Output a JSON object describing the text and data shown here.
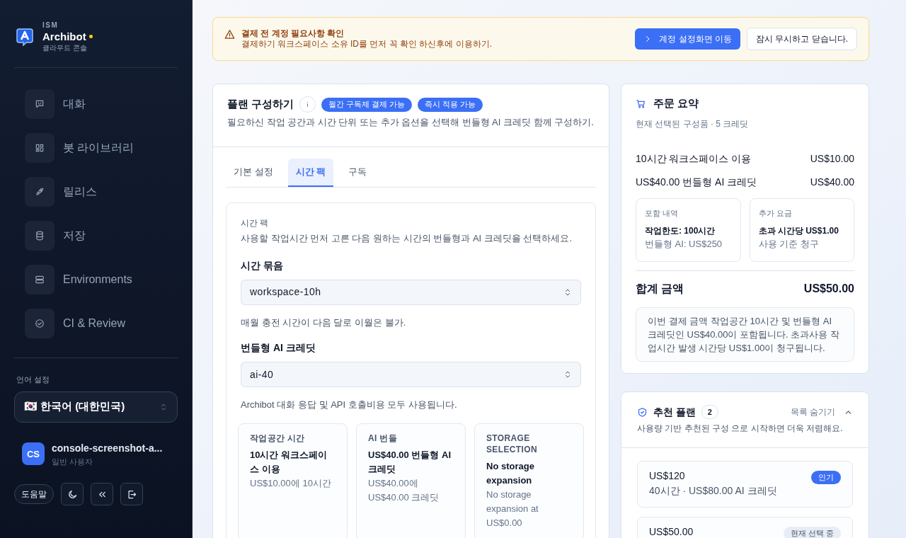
{
  "sidebar": {
    "brand": {
      "org": "ISM",
      "name": "Archibot",
      "subtitle": "클라우드 콘솔",
      "status_dot": true
    },
    "nav_items": [
      {
        "label": "대화"
      },
      {
        "label": "봇 라이브러리"
      },
      {
        "label": "릴리스"
      },
      {
        "label": "저장"
      },
      {
        "label": "Environments"
      },
      {
        "label": "CI & Review"
      }
    ],
    "language": {
      "label": "언어 설정",
      "value": "🇰🇷 한국어 (대한민국)"
    },
    "user": {
      "initials": "CS",
      "name": "console-screenshot-a...",
      "role": "일반 사용자"
    },
    "help_button": "도움말"
  },
  "banner": {
    "title": "결제 전 계정 필요사항 확인",
    "message": "결제하기 워크스페이스 소유 ID를 먼저 꼭 확인 하신후에 이용하기.",
    "primary_action": "계정 설정화면 이동",
    "secondary_action": "잠시 무시하고 닫습니다."
  },
  "plan_card": {
    "title": "플랜 구성하기",
    "badges": [
      "월간 구독제 결제 가능",
      "즉시 적용 가능"
    ],
    "description": "필요하신 작업 공간과 시간 단위 또는 추가 옵션을 선택해 번들형 AI 크레딧 함께 구성하기.",
    "tabs": [
      {
        "label": "기본 설정",
        "selected": false
      },
      {
        "label": "시간 팩",
        "selected": true
      },
      {
        "label": "구독",
        "selected": false
      }
    ],
    "panel": {
      "title": "시간 팩",
      "description": "사용할 작업시간 먼저 고른 다음 원하는 시간의 번들형과 AI 크레딧을 선택하세요.",
      "fields": [
        {
          "label": "시간 묶음",
          "value": "workspace-10h",
          "help": "매월 충전 시간이 다음 달로 이월은 불가."
        },
        {
          "label": "번들형 AI 크레딧",
          "value": "ai-40",
          "help": "Archibot 대화 응답 및 API 호출비용 모두 사용됩니다."
        }
      ],
      "options": [
        {
          "label": "작업공간 시간",
          "title": "10시간 워크스페이스 이용",
          "detail": "US$10.00에 10시간"
        },
        {
          "label": "AI 번들",
          "title": "US$40.00 번들형 AI 크레딧",
          "detail": "US$40.00에 US$40.00 크레딧"
        },
        {
          "label": "STORAGE SELECTION",
          "title": "No storage expansion",
          "detail": "No storage expansion at US$0.00"
        }
      ]
    }
  },
  "summary": {
    "title": "주문 요약",
    "subtitle": "현재 선택된 구성품 · 5 크레딧",
    "lines": [
      {
        "label": "10시간 워크스페이스 이용",
        "amount": "US$10.00"
      },
      {
        "label": "US$40.00 번들형 AI 크레딧",
        "amount": "US$40.00"
      }
    ],
    "details": [
      {
        "label": "포함 내역",
        "primary": "작업한도: 100시간",
        "secondary": "번들형 AI: US$250"
      },
      {
        "label": "추가 요금",
        "primary": "초과 시간당 US$1.00",
        "secondary": "사용 기준 청구"
      }
    ],
    "total": {
      "label": "합계 금액",
      "amount": "US$50.00"
    },
    "note": "이번 결제 금액 작업공간 10시간 및 번들형 AI 크레딧인 US$40.00이 포함됩니다. 초과사용 작업시간 발생 시간당 US$1.00이 청구됩니다."
  },
  "recommended": {
    "title": "추천 플랜",
    "count": "2",
    "toggle_label": "목록 숨기기",
    "expanded": true,
    "description": "사용량 기반 추천된 구성 으로 시작하면 더욱 저렴해요.",
    "items": [
      {
        "price": "US$120",
        "detail": "40시간 · US$80.00 AI 크레딧",
        "badge": "인기",
        "kind": "popular"
      },
      {
        "price": "US$50.00",
        "badge": "현재 선택 중",
        "kind": "current"
      }
    ]
  }
}
